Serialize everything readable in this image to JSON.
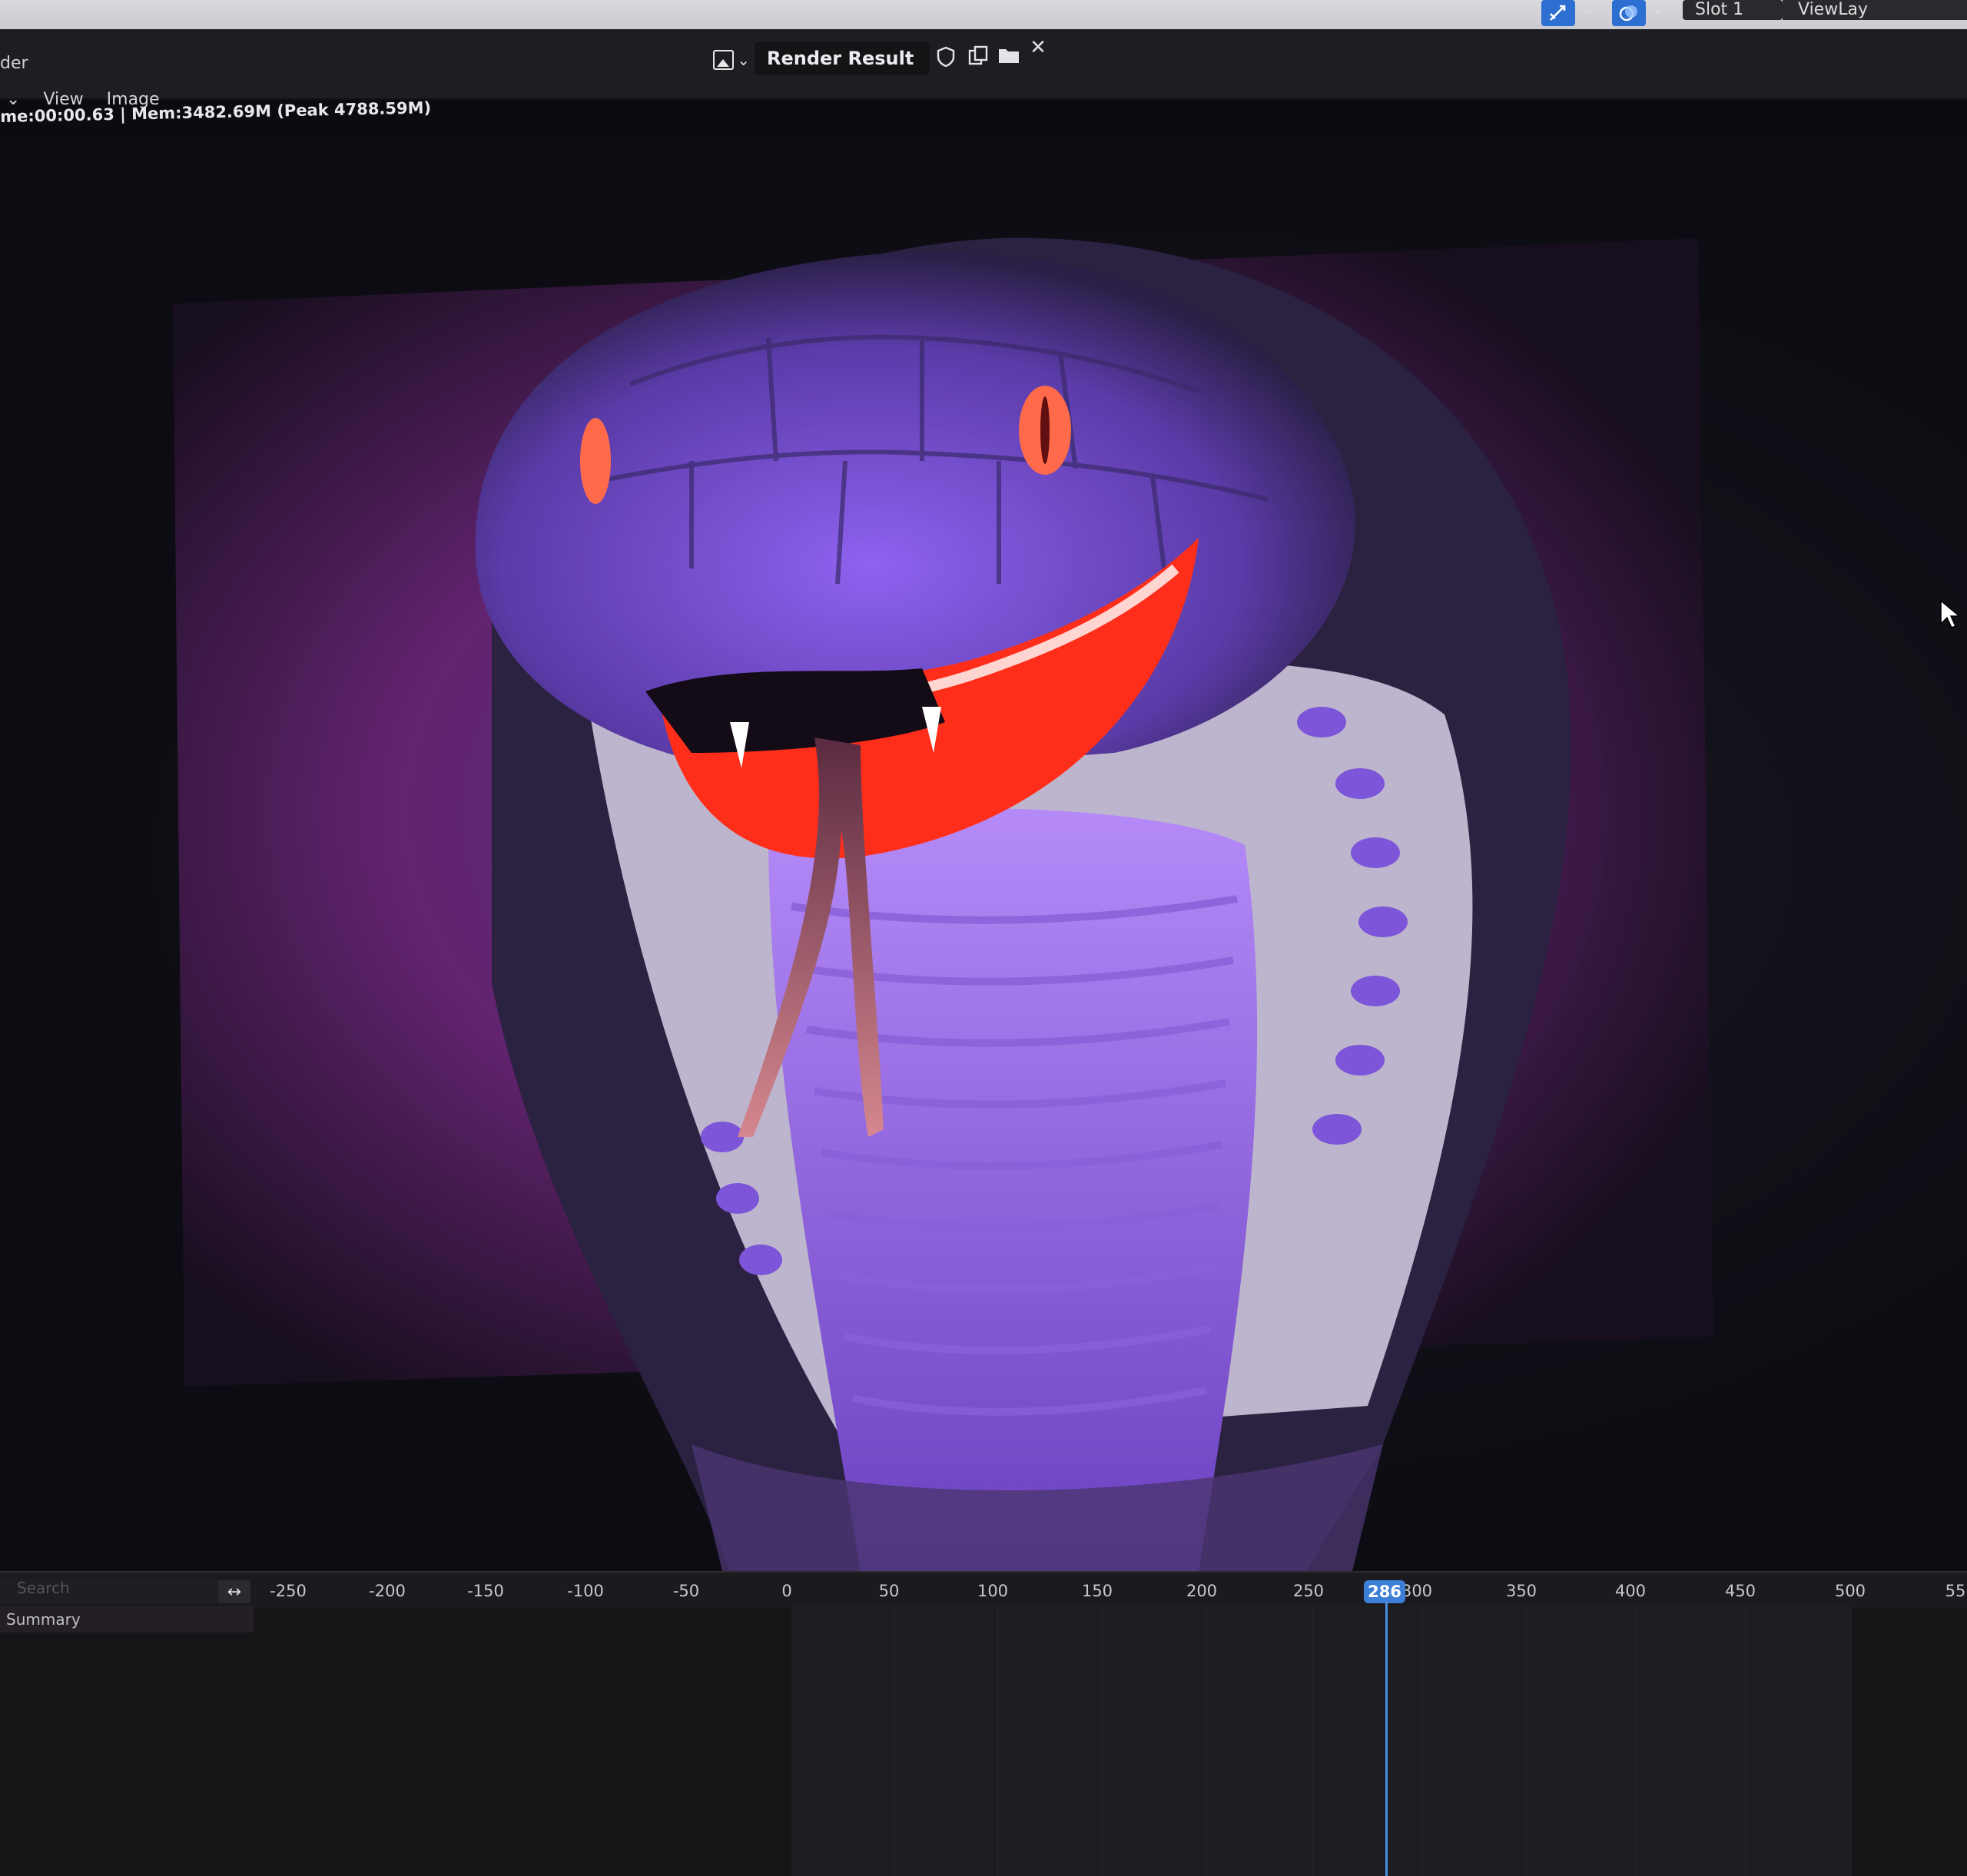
{
  "window": {
    "app_title_fragment": "der"
  },
  "header": {
    "image_name": "Render Result",
    "slot_label": "Slot 1",
    "view_layer_label": "ViewLay"
  },
  "menu": {
    "items": [
      "View",
      "Image"
    ]
  },
  "stats": {
    "text": "me:00:00.63 | Mem:3482.69M (Peak 4788.59M)"
  },
  "icons": {
    "image_browse": "image-icon",
    "fake_user": "shield-icon",
    "new_image": "duplicate-icon",
    "open_image": "folder-icon",
    "unlink": "close-icon",
    "tool": "sample-tool-icon",
    "overlay": "display-channels-icon",
    "cursor": "mouse-cursor-icon"
  },
  "timeline": {
    "search_placeholder": "Search",
    "swap_label": "↔",
    "summary_label": "Summary",
    "current_frame": "286",
    "ticks": [
      "-250",
      "-200",
      "-150",
      "-100",
      "-50",
      "0",
      "50",
      "100",
      "150",
      "200",
      "250",
      "300",
      "350",
      "400",
      "450",
      "500",
      "55"
    ]
  },
  "colors": {
    "accent_blue": "#3d7fd6",
    "panel_bg": "#1e1e22",
    "render_purple": "#7a4fd9",
    "render_magenta": "#c03fb0",
    "mouth_red": "#ff2e1a"
  }
}
